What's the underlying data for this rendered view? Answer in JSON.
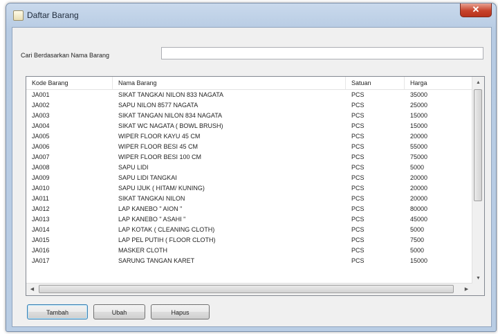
{
  "window": {
    "title": "Daftar Barang",
    "close_glyph": "✕"
  },
  "search": {
    "label": "Cari Berdasarkan Nama Barang",
    "value": ""
  },
  "grid": {
    "columns": [
      "Kode Barang",
      "Nama Barang",
      "Satuan",
      "Harga"
    ],
    "rows": [
      [
        "JA001",
        "SIKAT TANGKAI NILON 833 NAGATA",
        "PCS",
        "35000"
      ],
      [
        "JA002",
        "SAPU NILON 8577 NAGATA",
        "PCS",
        "25000"
      ],
      [
        "JA003",
        "SIKAT TANGAN NILON 834 NAGATA",
        "PCS",
        "15000"
      ],
      [
        "JA004",
        "SIKAT WC NAGATA ( BOWL BRUSH)",
        "PCS",
        "15000"
      ],
      [
        "JA005",
        "WIPER FLOOR KAYU 45 CM",
        "PCS",
        "20000"
      ],
      [
        "JA006",
        "WIPER FLOOR BESI 45 CM",
        "PCS",
        "55000"
      ],
      [
        "JA007",
        "WIPER FLOOR BESI 100 CM",
        "PCS",
        "75000"
      ],
      [
        "JA008",
        "SAPU LIDI",
        "PCS",
        "5000"
      ],
      [
        "JA009",
        "SAPU LIDI TANGKAI",
        "PCS",
        "20000"
      ],
      [
        "JA010",
        "SAPU IJUK ( HITAM/ KUNING)",
        "PCS",
        "20000"
      ],
      [
        "JA011",
        "SIKAT TANGKAI NILON",
        "PCS",
        "20000"
      ],
      [
        "JA012",
        "LAP KANEBO \" AION \"",
        "PCS",
        "80000"
      ],
      [
        "JA013",
        "LAP KANEBO \" ASAHI \"",
        "PCS",
        "45000"
      ],
      [
        "JA014",
        "LAP KOTAK ( CLEANING CLOTH)",
        "PCS",
        "5000"
      ],
      [
        "JA015",
        "LAP PEL PUTIH ( FLOOR CLOTH)",
        "PCS",
        "7500"
      ],
      [
        "JA016",
        "MASKER CLOTH",
        "PCS",
        "5000"
      ],
      [
        "JA017",
        "SARUNG TANGAN KARET",
        "PCS",
        "15000"
      ]
    ]
  },
  "buttons": {
    "add": "Tambah",
    "edit": "Ubah",
    "delete": "Hapus"
  },
  "icons": {
    "scroll_up": "▲",
    "scroll_down": "▼",
    "scroll_left": "◀",
    "scroll_right": "▶"
  }
}
